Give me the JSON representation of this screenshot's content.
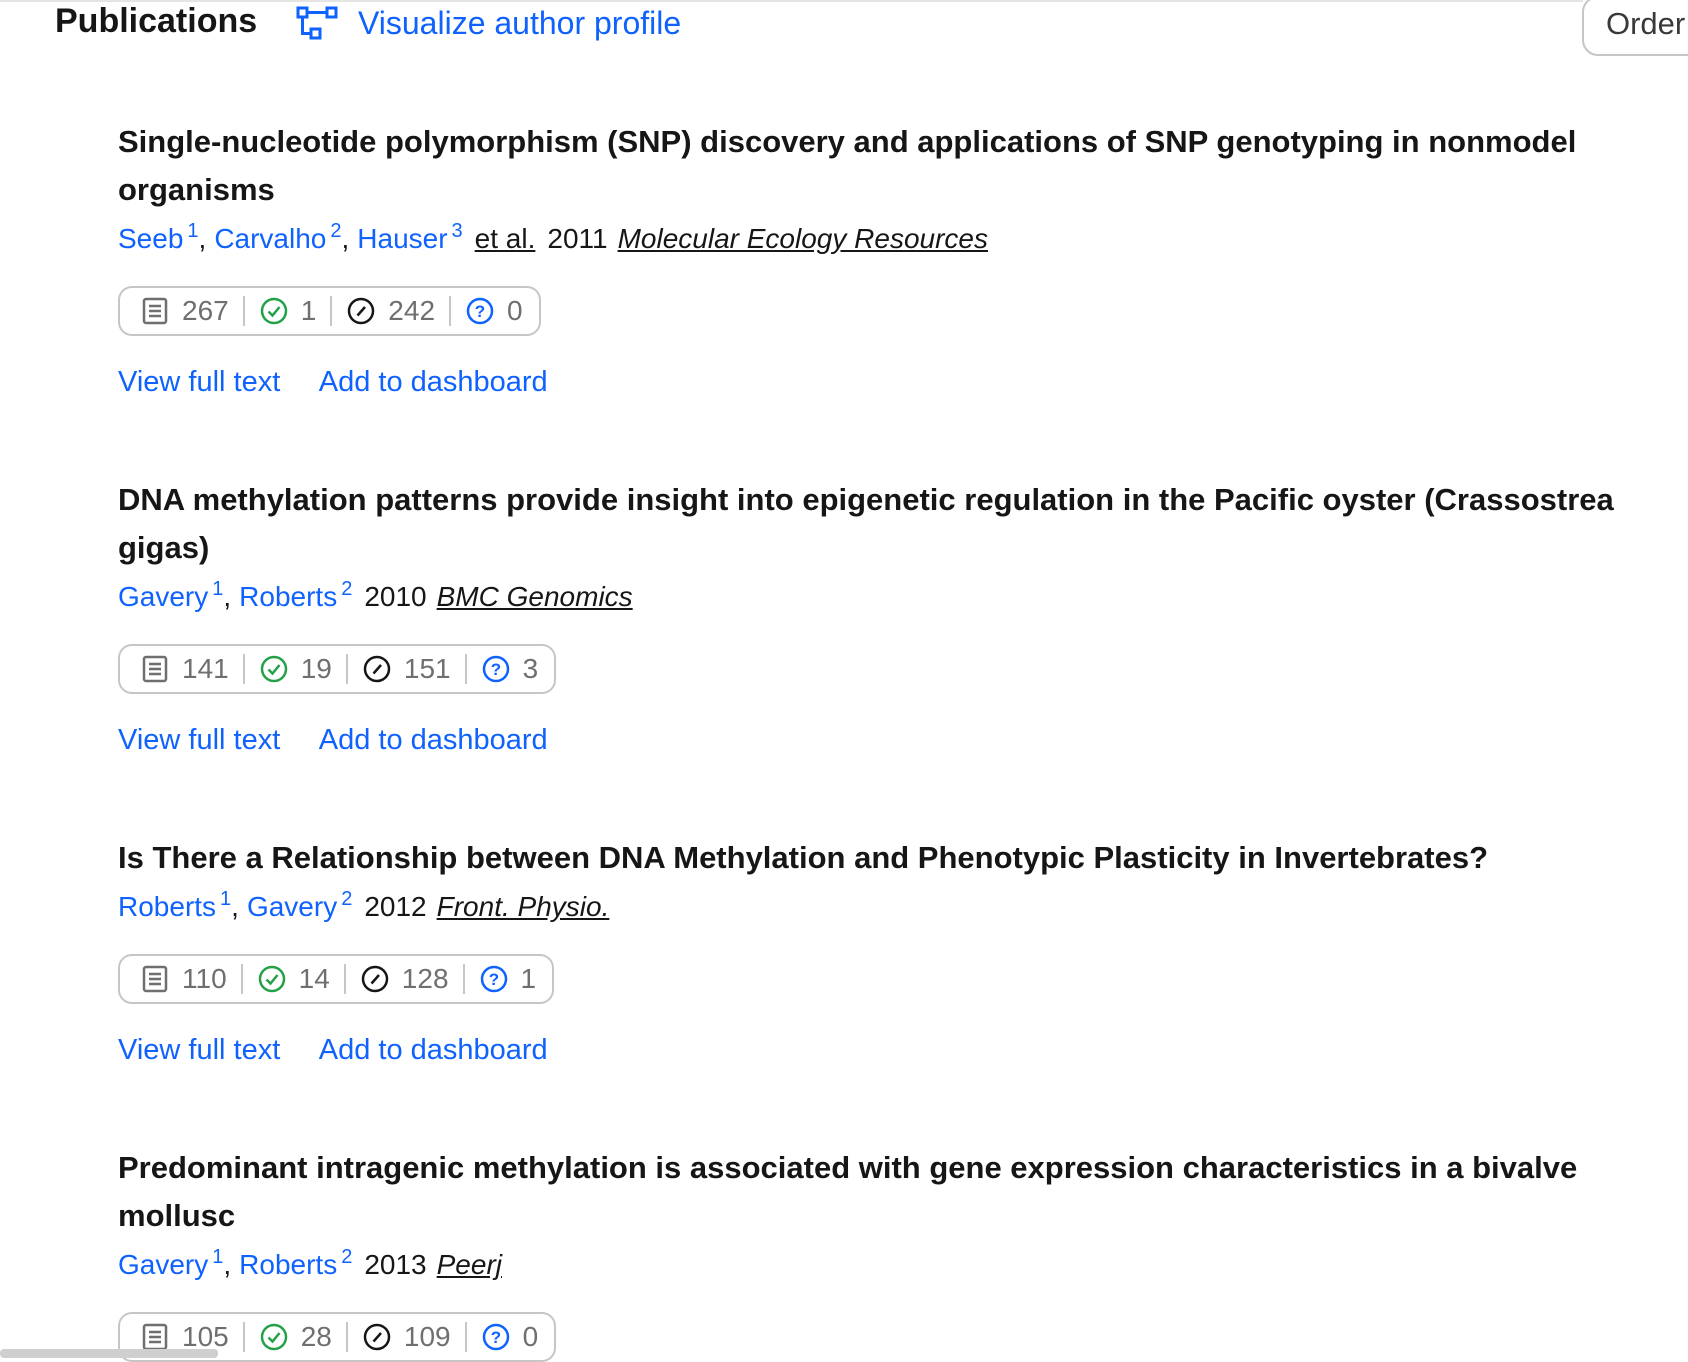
{
  "header": {
    "title": "Publications",
    "visualize_label": "Visualize author profile",
    "order_label": "Order"
  },
  "publications": [
    {
      "title": "Single-nucleotide polymorphism (SNP) discovery and applications of SNP genotyping in nonmodel organisms",
      "authors": [
        {
          "name": "Seeb",
          "sup": "1"
        },
        {
          "name": "Carvalho",
          "sup": "2"
        },
        {
          "name": "Hauser",
          "sup": "3"
        }
      ],
      "etal": "et al.",
      "year": "2011",
      "journal": "Molecular Ecology Resources",
      "stats": {
        "citing": "267",
        "supporting": "1",
        "mentioning": "242",
        "contrasting": "0"
      },
      "view_label": "View full text",
      "dashboard_label": "Add to dashboard"
    },
    {
      "title": "DNA methylation patterns provide insight into epigenetic regulation in the Pacific oyster (Crassostrea gigas)",
      "authors": [
        {
          "name": "Gavery",
          "sup": "1"
        },
        {
          "name": "Roberts",
          "sup": "2"
        }
      ],
      "year": "2010",
      "journal": "BMC Genomics",
      "stats": {
        "citing": "141",
        "supporting": "19",
        "mentioning": "151",
        "contrasting": "3"
      },
      "view_label": "View full text",
      "dashboard_label": "Add to dashboard"
    },
    {
      "title": "Is There a Relationship between DNA Methylation and Phenotypic Plasticity in Invertebrates?",
      "authors": [
        {
          "name": "Roberts",
          "sup": "1"
        },
        {
          "name": "Gavery",
          "sup": "2"
        }
      ],
      "year": "2012",
      "journal": "Front. Physio.",
      "stats": {
        "citing": "110",
        "supporting": "14",
        "mentioning": "128",
        "contrasting": "1"
      },
      "view_label": "View full text",
      "dashboard_label": "Add to dashboard"
    },
    {
      "title": "Predominant intragenic methylation is associated with gene expression characteristics in a bivalve mollusc",
      "authors": [
        {
          "name": "Gavery",
          "sup": "1"
        },
        {
          "name": "Roberts",
          "sup": "2"
        }
      ],
      "year": "2013",
      "journal": "Peerj",
      "stats": {
        "citing": "105",
        "supporting": "28",
        "mentioning": "109",
        "contrasting": "0"
      }
    }
  ],
  "colors": {
    "link": "#0f62fe",
    "supporting": "#24a148",
    "contrasting_icon": "#0f62fe",
    "border": "#c6c6c6",
    "muted": "#6f6f6f"
  },
  "icons": [
    "network-icon",
    "document-icon",
    "check-circle-icon",
    "slash-circle-icon",
    "question-circle-icon"
  ]
}
